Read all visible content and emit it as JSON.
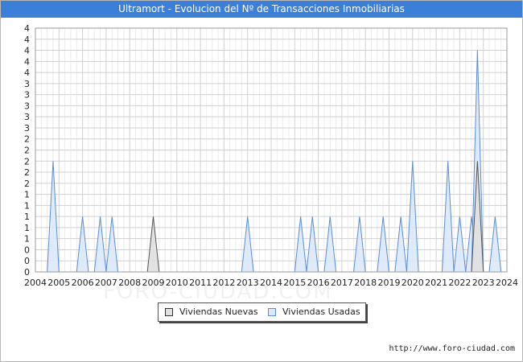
{
  "title": "Ultramort - Evolucion del Nº de Transacciones Inmobiliarias",
  "footer": "http://www.foro-ciudad.com",
  "watermark": "FORO-CIUDAD.COM",
  "legend": {
    "nuevas": "Viviendas Nuevas",
    "usadas": "Viviendas Usadas"
  },
  "colors": {
    "title_bg": "#3b7fd9",
    "nuevas_fill": "#e0e0e0",
    "nuevas_stroke": "#555555",
    "usadas_fill": "#dce9fb",
    "usadas_stroke": "#5b8ed6",
    "grid": "#d0d0d0"
  },
  "chart_data": {
    "type": "area",
    "title": "Ultramort - Evolucion del Nº de Transacciones Inmobiliarias",
    "xlabel": "",
    "ylabel": "",
    "x_ticks": [
      "2004",
      "2005",
      "2006",
      "2007",
      "2008",
      "2009",
      "2010",
      "2011",
      "2012",
      "2013",
      "2014",
      "2015",
      "2016",
      "2017",
      "2018",
      "2019",
      "2020",
      "2021",
      "2022",
      "2023",
      "2024"
    ],
    "y_tick_labels": [
      "0",
      "0",
      "0",
      "1",
      "1",
      "1",
      "1",
      "1",
      "2",
      "2",
      "2",
      "2",
      "2",
      "3",
      "3",
      "3",
      "3",
      "3",
      "4",
      "4",
      "4",
      "4",
      "4"
    ],
    "ylim": [
      0,
      4.4
    ],
    "grid": true,
    "legend_position": "bottom",
    "series": [
      {
        "name": "Viviendas Nuevas",
        "points": [
          {
            "x": 2004.0,
            "y": 0
          },
          {
            "x": 2009.0,
            "y": 1
          },
          {
            "x": 2022.75,
            "y": 2
          }
        ]
      },
      {
        "name": "Viviendas Usadas",
        "points": [
          {
            "x": 2004.75,
            "y": 2
          },
          {
            "x": 2006.0,
            "y": 1
          },
          {
            "x": 2006.75,
            "y": 1
          },
          {
            "x": 2007.25,
            "y": 1
          },
          {
            "x": 2013.0,
            "y": 1
          },
          {
            "x": 2015.25,
            "y": 1
          },
          {
            "x": 2015.75,
            "y": 1
          },
          {
            "x": 2016.5,
            "y": 1
          },
          {
            "x": 2017.75,
            "y": 1
          },
          {
            "x": 2018.75,
            "y": 1
          },
          {
            "x": 2019.5,
            "y": 1
          },
          {
            "x": 2020.0,
            "y": 2
          },
          {
            "x": 2021.5,
            "y": 2
          },
          {
            "x": 2022.0,
            "y": 1
          },
          {
            "x": 2022.5,
            "y": 1
          },
          {
            "x": 2022.75,
            "y": 4
          },
          {
            "x": 2023.5,
            "y": 1
          }
        ]
      }
    ]
  }
}
